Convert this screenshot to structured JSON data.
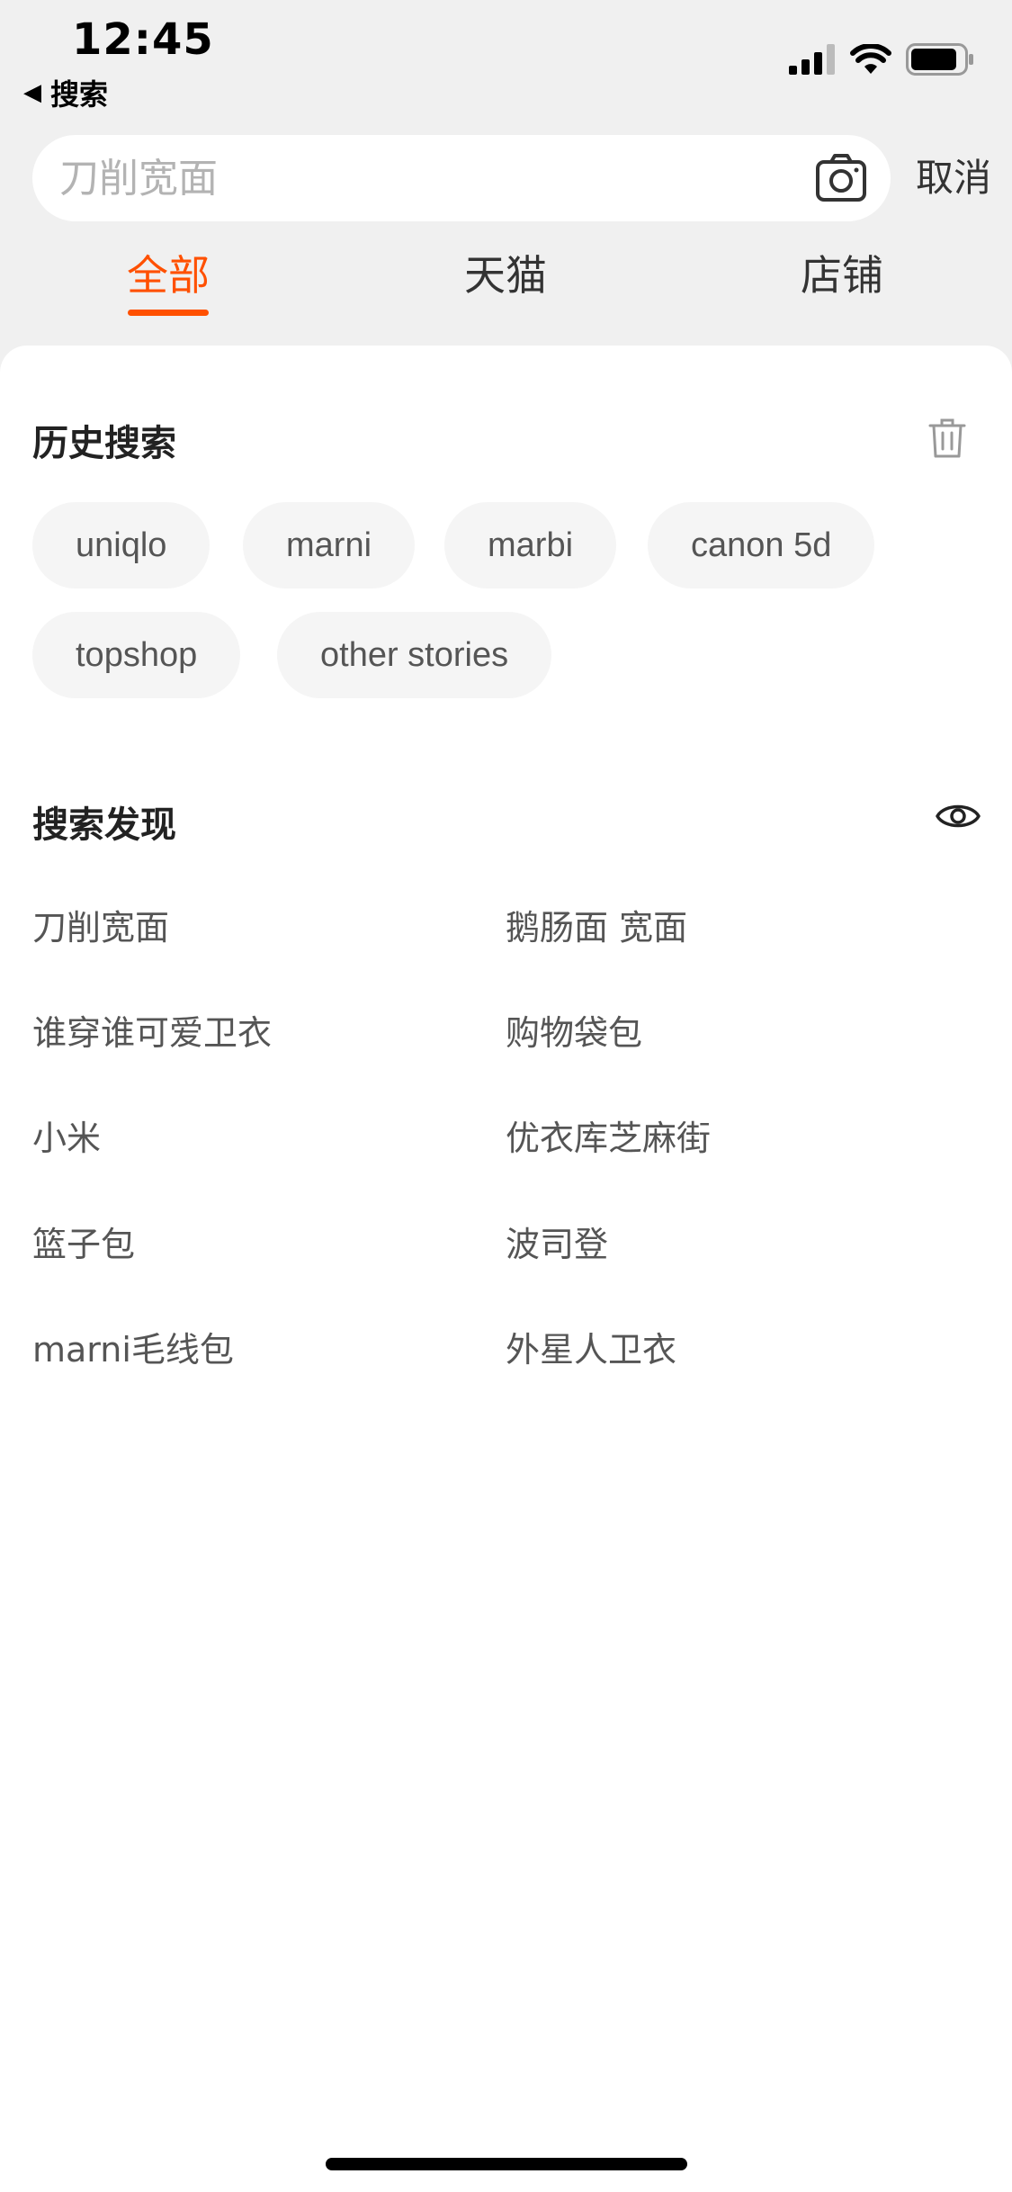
{
  "status_bar": {
    "time": "12:45",
    "back_label": "搜索",
    "icons": [
      "cellular-signal-icon",
      "wifi-icon",
      "battery-icon"
    ]
  },
  "search": {
    "placeholder": "刀削宽面",
    "value": "",
    "camera_icon": "camera-icon",
    "cancel_label": "取消"
  },
  "tabs": [
    {
      "label": "全部",
      "active": true
    },
    {
      "label": "天猫",
      "active": false
    },
    {
      "label": "店铺",
      "active": false
    }
  ],
  "history": {
    "title": "历史搜索",
    "clear_icon": "trash-icon",
    "chips": [
      "uniqlo",
      "marni",
      "marbi",
      "canon 5d",
      "topshop",
      "other stories"
    ]
  },
  "discover": {
    "title": "搜索发现",
    "toggle_icon": "eye-icon",
    "items": [
      "刀削宽面",
      "鹅肠面 宽面",
      "谁穿谁可爱卫衣",
      "购物袋包",
      "小米",
      "优衣库芝麻街",
      "篮子包",
      "波司登",
      "marni毛线包",
      "外星人卫衣"
    ]
  },
  "colors": {
    "accent": "#ff5000",
    "background": "#f0f0f0",
    "panel": "#ffffff",
    "chip": "#f5f5f5"
  }
}
